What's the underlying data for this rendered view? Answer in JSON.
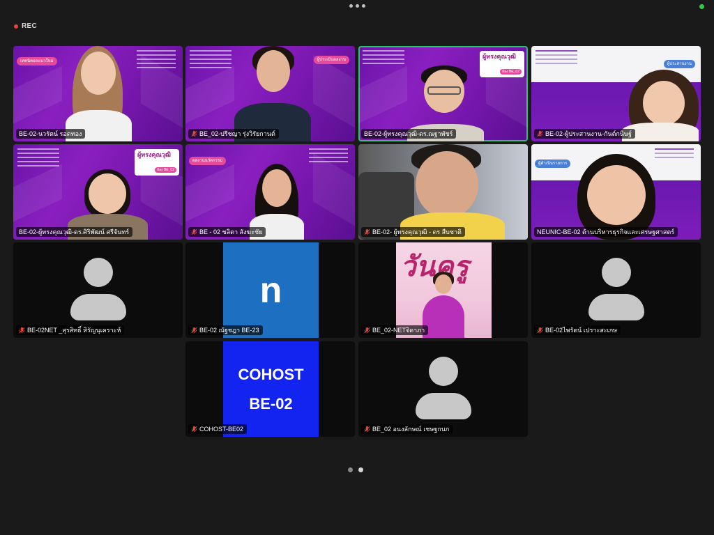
{
  "recording": {
    "label": "REC"
  },
  "colors": {
    "active_speaker_border": "#2cc36b",
    "rec_dot": "#e0463a",
    "mic_muted": "#e0463a"
  },
  "participants": [
    {
      "name": "BE-02-นวรัตน์ รอดทอง",
      "muted": false,
      "chip": "เทคนิคอลแนวใหม่"
    },
    {
      "name": "BE_02-ปรีชญา รุ่งวิรัยกานต์",
      "muted": true,
      "chip": "ผู้ประเมินผลงาน"
    },
    {
      "name": "BE-02-ผู้ทรงคุณวุฒิ-ดร.ณฐาพัชร์",
      "muted": false,
      "active": true,
      "badge_title": "ผู้ทรงคุณวุฒิ",
      "badge_room": "ห้อง BE_02"
    },
    {
      "name": "BE-02-ผู้ประสานงาน-กันต์กนิษฐ์",
      "muted": true,
      "chip": "ผู้ประสานงาน"
    },
    {
      "name": "BE-02-ผู้ทรงคุณวุฒิ-ดร.ศิริพัฒน์ ศรีจันทร์",
      "muted": false,
      "badge_title": "ผู้ทรงคุณวุฒิ",
      "badge_room": "ห้อง BE_02"
    },
    {
      "name": "BE - 02 ชลิตา สังฆะชัย",
      "muted": true,
      "chip": "ผลงานนวัตกรรม"
    },
    {
      "name": "BE-02- ผู้ทรงคุณวุฒิ - ดร สืบชาติ",
      "muted": true
    },
    {
      "name": "NEUNIC-BE-02 ด้านบริหารธุรกิจและเศรษฐศาสตร์",
      "muted": false,
      "chip": "ผู้ดำเนินรายการ"
    },
    {
      "name": "BE-02NET _สุรสิทธิ์ หิรัญนุเคราะห์",
      "muted": true
    },
    {
      "name": "BE-02 ณัฐชฎา BE-23",
      "muted": true,
      "initial": "n"
    },
    {
      "name": "BE_02-NETจิดาภา",
      "muted": true,
      "photo_text": "วันครู"
    },
    {
      "name": "BE-02ไพรัตน์ เปราะสะเกษ",
      "muted": true
    },
    {
      "name": "COHOST-BE02",
      "muted": true,
      "card_line1": "COHOST",
      "card_line2": "BE-02"
    },
    {
      "name": "BE_02 อนงลักษณ์ เชษฐกนก",
      "muted": true
    }
  ],
  "pager": {
    "pages": 2,
    "current": 2
  }
}
